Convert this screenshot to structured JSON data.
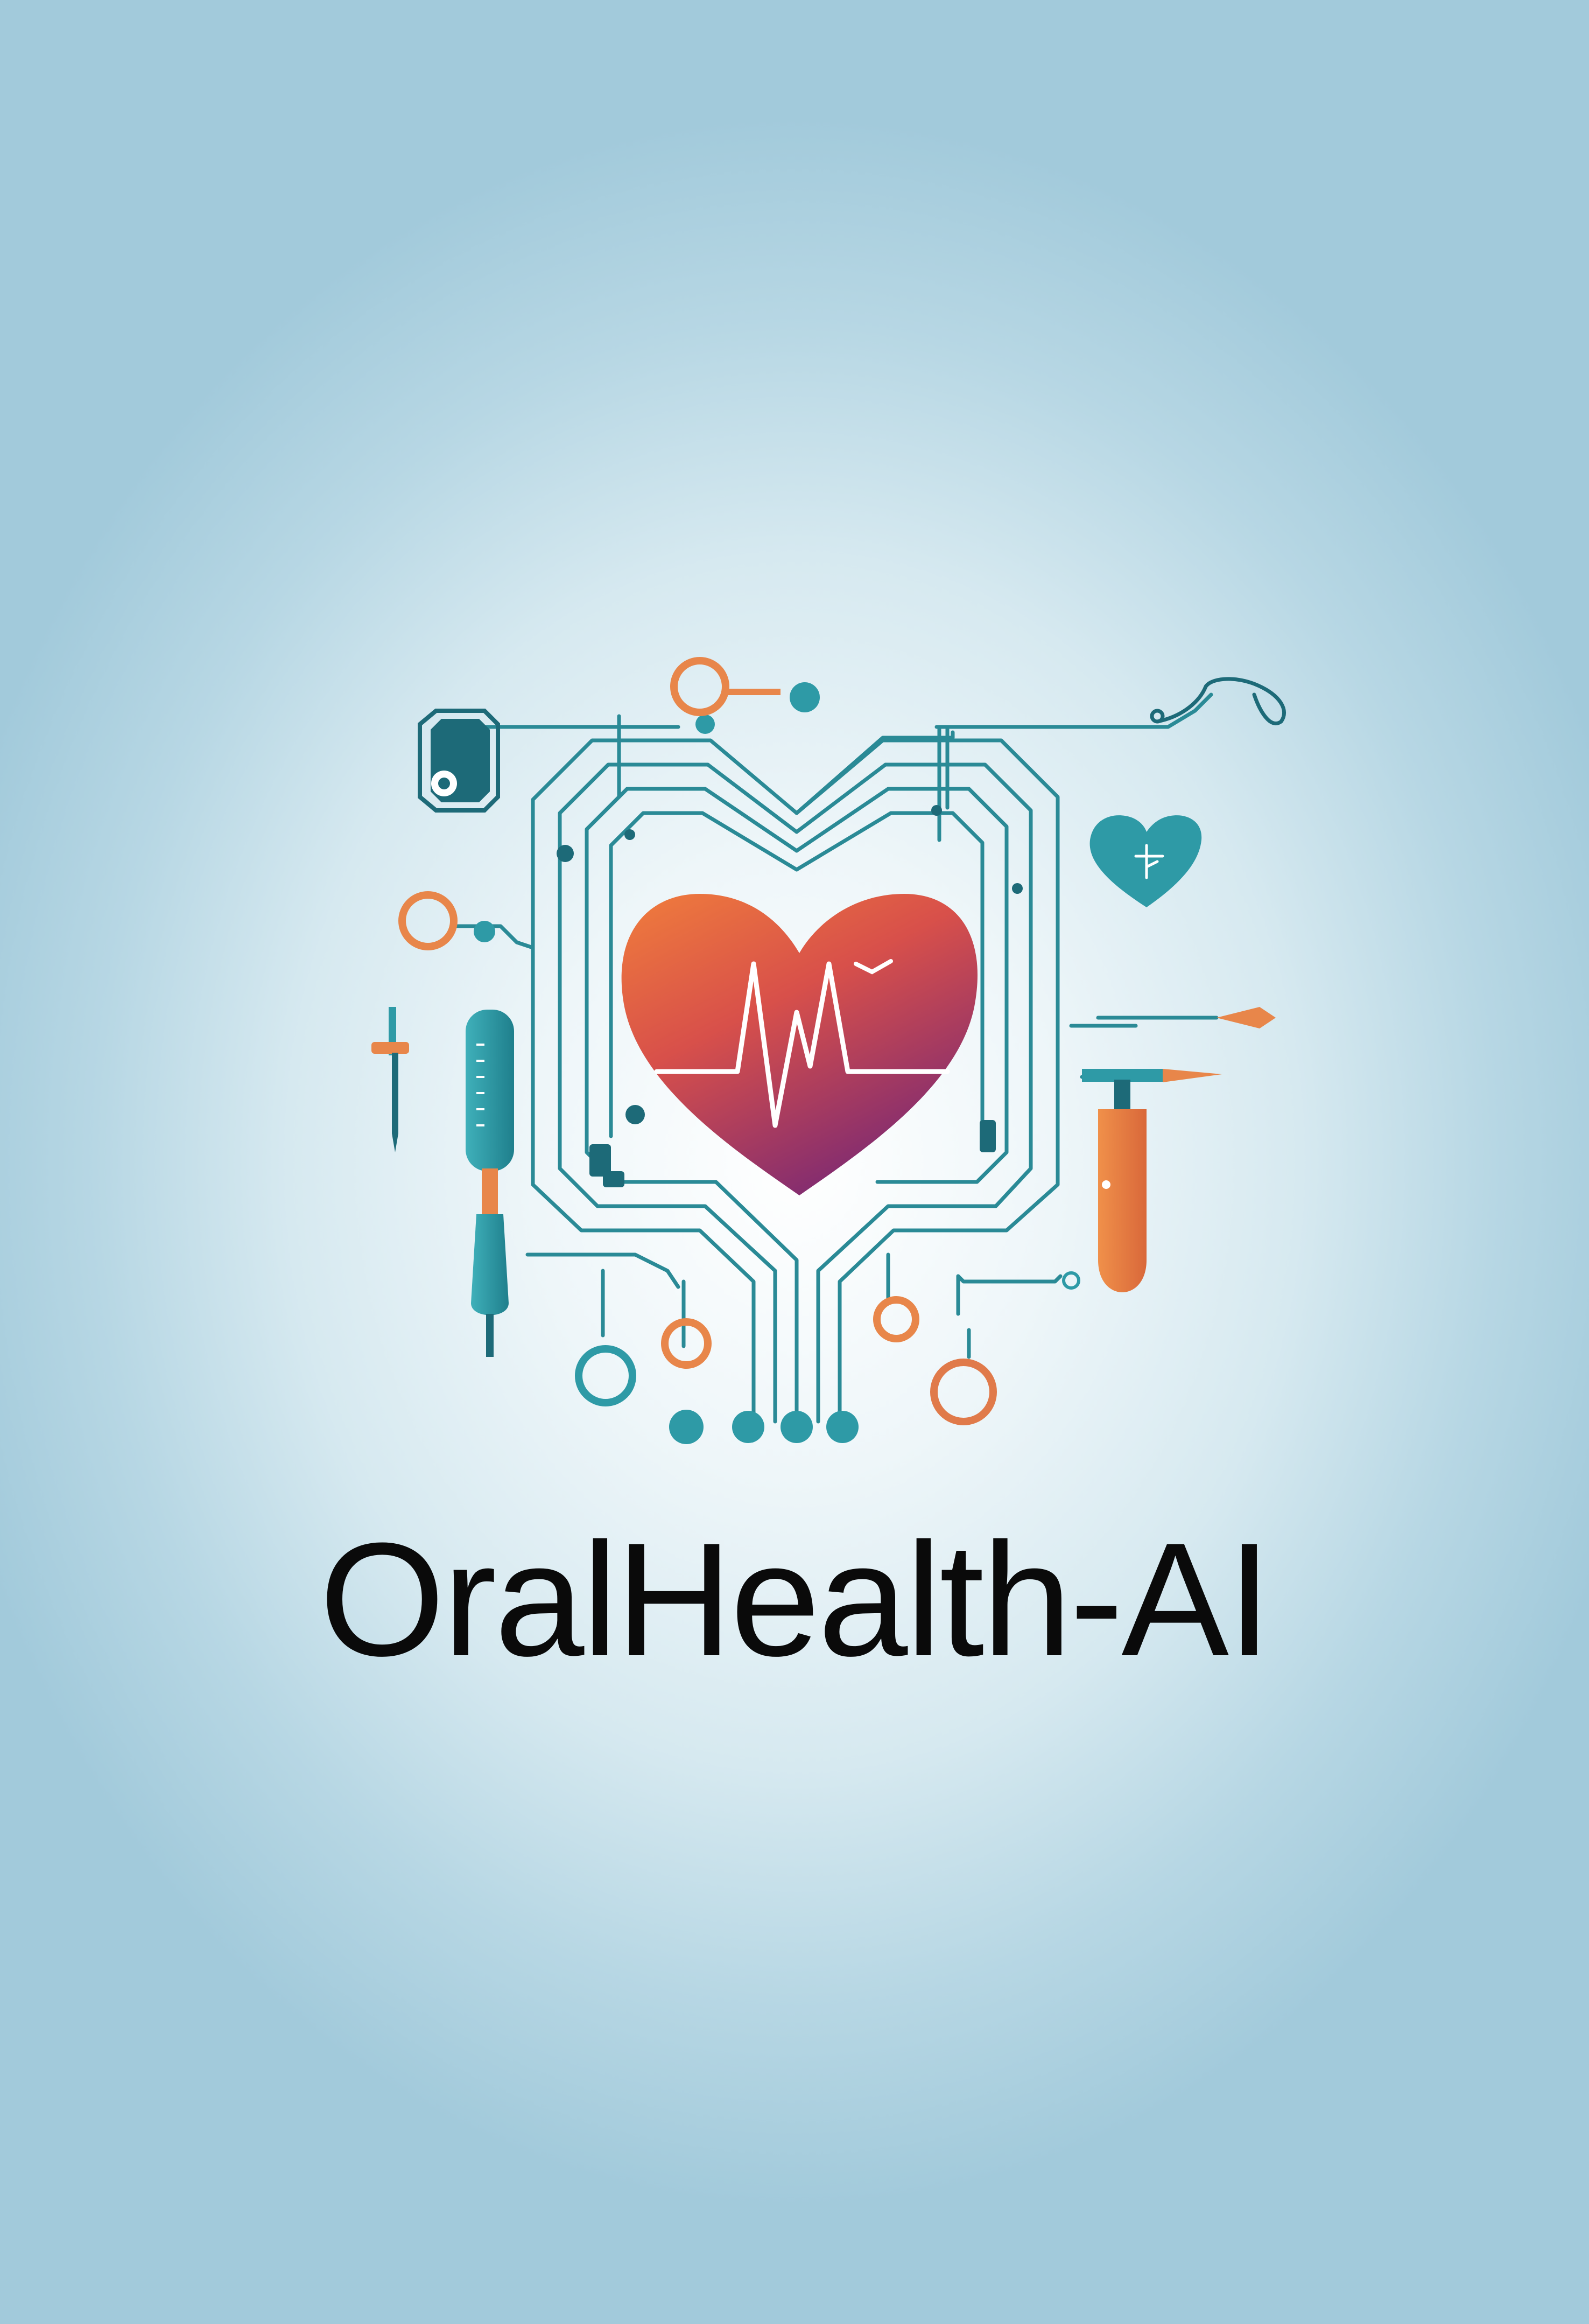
{
  "brand": {
    "name": "OralHealth-AI"
  },
  "colors": {
    "circuit": "#2a8a96",
    "circuit_dark": "#1d6a78",
    "teal_fill": "#2e9aa6",
    "orange": "#e8864a",
    "heart_top": "#ef7a3e",
    "heart_bottom": "#8e2c6c",
    "text": "#0a0a0a"
  },
  "icons": [
    "heart-pulse-icon",
    "small-heart-icon",
    "dental-drill-icon",
    "toothbrush-icon",
    "scalpel-icon",
    "probe-icon",
    "mirror-icon"
  ]
}
